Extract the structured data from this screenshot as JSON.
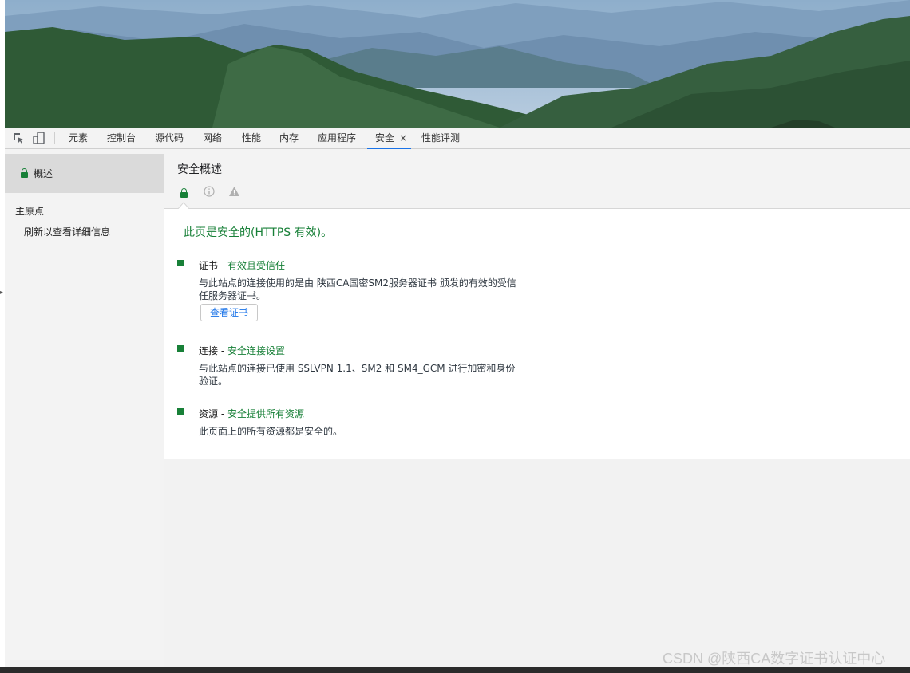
{
  "toolbar": {
    "tabs": [
      "元素",
      "控制台",
      "源代码",
      "网络",
      "性能",
      "内存",
      "应用程序",
      "安全",
      "性能评测"
    ],
    "active_tab": "安全",
    "close_symbol": "×"
  },
  "sidebar": {
    "overview_label": "概述",
    "main_origin_label": "主原点",
    "refresh_hint": "刷新以查看详细信息"
  },
  "header": {
    "title": "安全概述"
  },
  "content": {
    "summary": "此页是安全的(HTTPS 有效)。",
    "certificate": {
      "label": "证书",
      "status": "有效且受信任",
      "description": "与此站点的连接使用的是由 陕西CA国密SM2服务器证书 颁发的有效的受信任服务器证书。",
      "button_label": "查看证书"
    },
    "connection": {
      "label": "连接",
      "status": "安全连接设置",
      "description": "与此站点的连接已使用 SSLVPN 1.1、SM2 和 SM4_GCM 进行加密和身份验证。"
    },
    "resources": {
      "label": "资源",
      "status": "安全提供所有资源",
      "description": "此页面上的所有资源都是安全的。"
    },
    "separator": " - "
  },
  "watermark": "CSDN @陕西CA数字证书认证中心",
  "colors": {
    "secure_green": "#188038",
    "active_tab_underline": "#1a73e8",
    "link_blue": "#1a73e8"
  },
  "icons": [
    "inspect-element-icon",
    "device-toggle-icon",
    "lock-icon",
    "info-icon",
    "warning-icon"
  ]
}
